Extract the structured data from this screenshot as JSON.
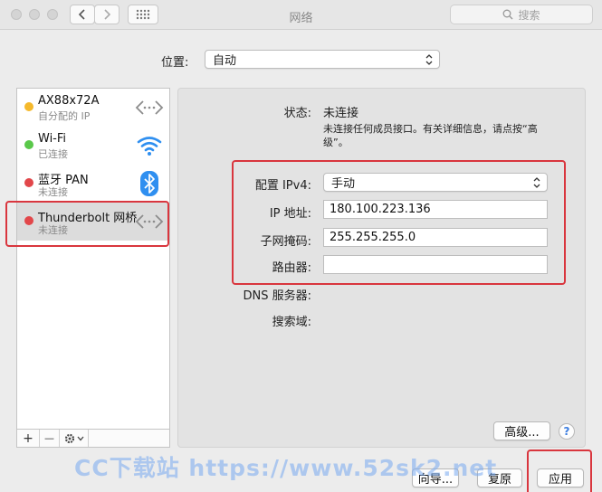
{
  "window": {
    "title": "网络",
    "search_placeholder": "搜索"
  },
  "location": {
    "label": "位置:",
    "value": "自动"
  },
  "services": [
    {
      "name": "AX88x72A",
      "status": "自分配的 IP",
      "dot_color": "#f5b92c",
      "icon": "arrows-icon"
    },
    {
      "name": "Wi-Fi",
      "status": "已连接",
      "dot_color": "#5ac84a",
      "icon": "wifi-icon"
    },
    {
      "name": "蓝牙 PAN",
      "status": "未连接",
      "dot_color": "#e2474a",
      "icon": "bluetooth-icon"
    },
    {
      "name": "Thunderbolt 网桥",
      "status": "未连接",
      "dot_color": "#e2474a",
      "icon": "arrows-icon"
    }
  ],
  "sidebar_toolbar": {
    "add": "+",
    "remove": "—"
  },
  "detail": {
    "status_label": "状态:",
    "status_value": "未连接",
    "status_desc": "未连接任何成员接口。有关详细信息，请点按“高级”。",
    "ipv4_label": "配置 IPv4:",
    "ipv4_value": "手动",
    "ip_label": "IP 地址:",
    "ip_value": "180.100.223.136",
    "mask_label": "子网掩码:",
    "mask_value": "255.255.255.0",
    "router_label": "路由器:",
    "router_value": "",
    "dns_label": "DNS 服务器:",
    "search_domain_label": "搜索域:"
  },
  "buttons": {
    "advanced": "高级...",
    "help": "?",
    "assist": "向导...",
    "revert": "复原",
    "apply": "应用"
  },
  "watermark": "CC下载站  https://www.52sk2.net",
  "colors": {
    "highlight": "#d9363e",
    "selected_row": "#dcdcdc",
    "wifi": "#2f8ff0",
    "bluetooth": "#2f8ff0"
  }
}
